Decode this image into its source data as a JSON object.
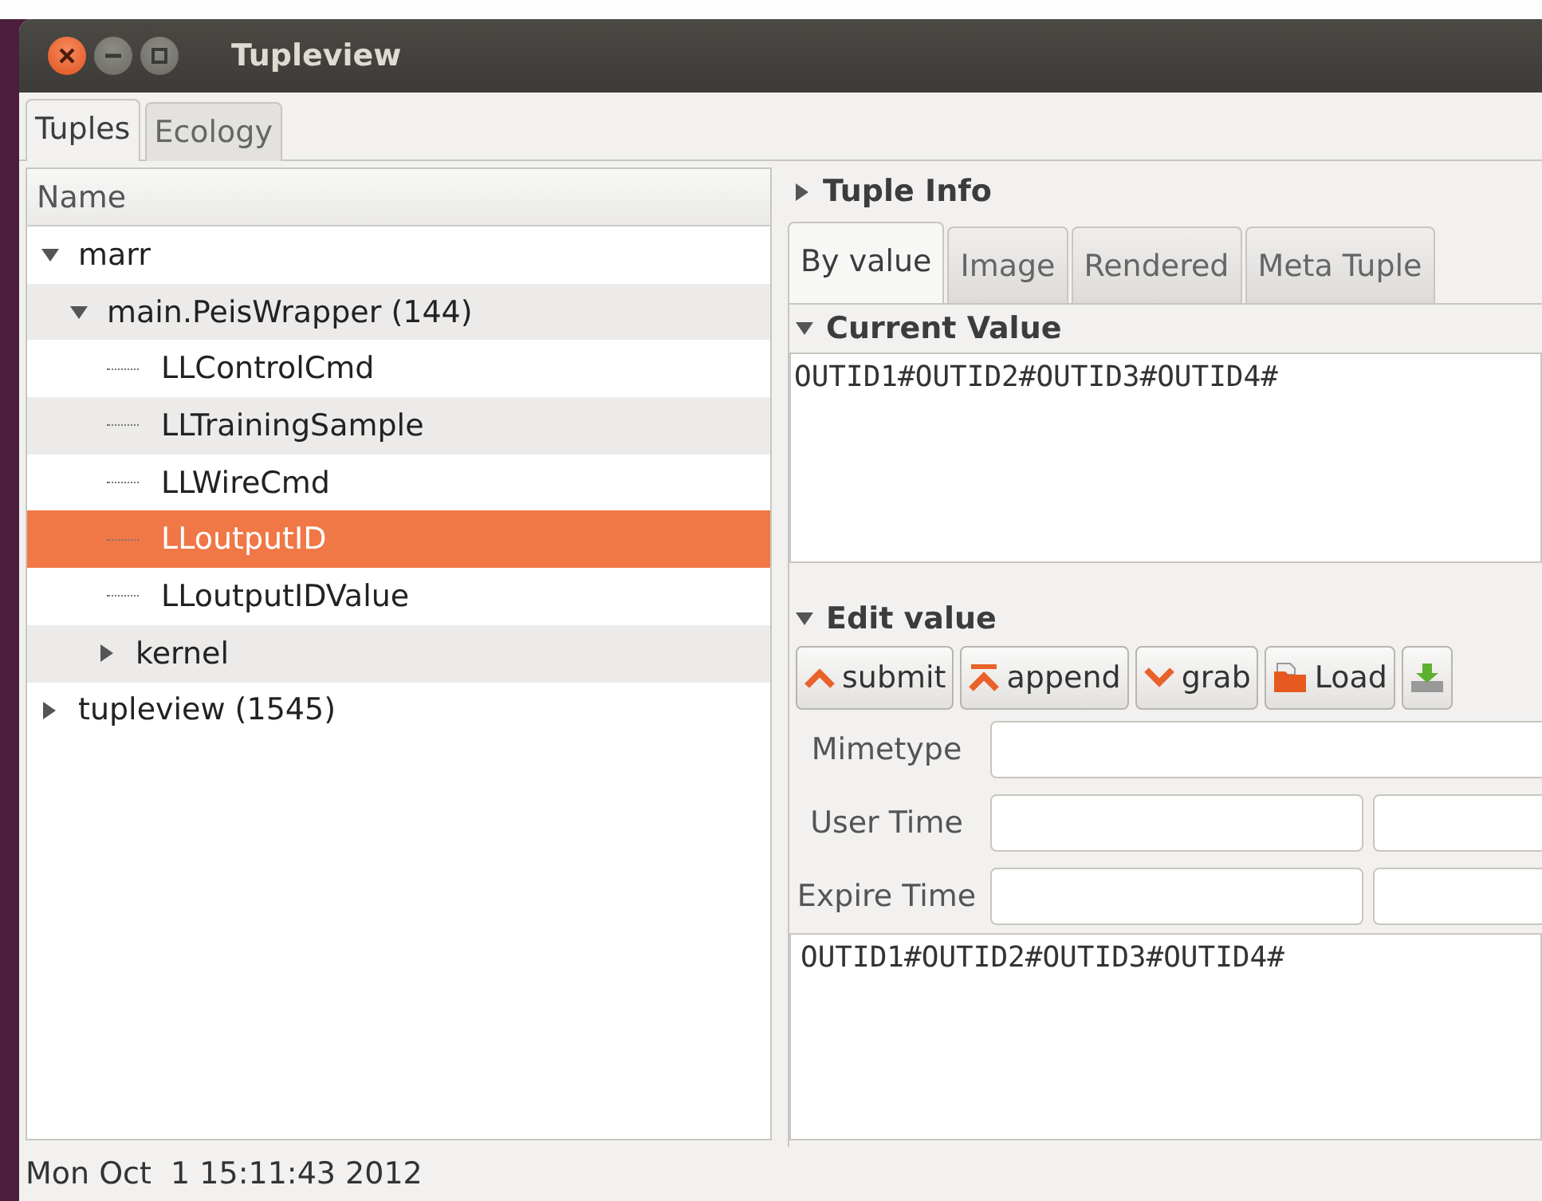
{
  "window": {
    "title": "Tupleview"
  },
  "tabs": [
    {
      "label": "Tuples",
      "selected": true
    },
    {
      "label": "Ecology",
      "selected": false
    }
  ],
  "tree": {
    "header": "Name",
    "nodes": [
      {
        "label": "marr",
        "expanded": true,
        "selected": false,
        "children": [
          {
            "label": "main.PeisWrapper (144)",
            "expanded": true,
            "selected": false,
            "children": [
              {
                "label": "LLControlCmd",
                "selected": false
              },
              {
                "label": "LLTrainingSample",
                "selected": false
              },
              {
                "label": "LLWireCmd",
                "selected": false
              },
              {
                "label": "LLoutputID",
                "selected": true
              },
              {
                "label": "LLoutputIDValue",
                "selected": false
              },
              {
                "label": "kernel",
                "expanded": false,
                "selected": false
              }
            ]
          }
        ]
      },
      {
        "label": "tupleview (1545)",
        "expanded": false,
        "selected": false
      }
    ]
  },
  "tuple_info": {
    "title": "Tuple Info",
    "expanded": false,
    "tabs": [
      {
        "label": "By value",
        "selected": true
      },
      {
        "label": "Image",
        "selected": false
      },
      {
        "label": "Rendered",
        "selected": false
      },
      {
        "label": "Meta Tuple",
        "selected": false
      }
    ]
  },
  "current_value": {
    "title": "Current Value",
    "expanded": true,
    "value": "OUTID1#OUTID2#OUTID3#OUTID4#"
  },
  "edit_value": {
    "title": "Edit value",
    "expanded": true,
    "buttons": [
      {
        "kind": "submit",
        "label": "submit"
      },
      {
        "kind": "append",
        "label": "append"
      },
      {
        "kind": "grab",
        "label": "grab"
      },
      {
        "kind": "load",
        "label": "Load"
      },
      {
        "kind": "save"
      }
    ],
    "fields": [
      {
        "label": "Mimetype",
        "kind": "single"
      },
      {
        "label": "User Time",
        "kind": "double"
      },
      {
        "label": "Expire Time",
        "kind": "double"
      }
    ],
    "value": "OUTID1#OUTID2#OUTID3#OUTID4#"
  },
  "status_bar": "Mon Oct  1 15:11:43 2012"
}
